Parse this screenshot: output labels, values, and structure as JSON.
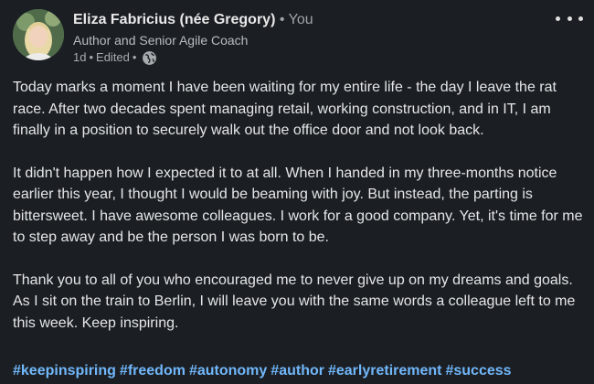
{
  "author": {
    "name": "Eliza Fabricius (née Gregory)",
    "bullet": "•",
    "relation": "You",
    "headline": "Author and Senior Agile Coach",
    "time": "1d",
    "edited": "Edited",
    "visibility_icon": "globe-icon"
  },
  "menu_icon": "more-options-icon",
  "post": {
    "paragraphs": [
      "Today marks a moment I have been waiting for my entire life - the day I leave the rat race. After two decades spent managing retail, working construction, and in IT, I am finally in a position to securely walk out the office door and not look back.",
      "It didn't happen how I expected it to at all. When I handed in my three-months notice earlier this year, I thought I would be beaming with joy. But instead, the parting is bittersweet. I have awesome colleagues. I work for a good company. Yet, it's time for me to step away and be the person I was born to be.",
      "Thank you to all of you who encouraged me to never give up on my dreams and goals. As I sit on the train to Berlin, I will leave you with the same words a colleague left to me this week. Keep inspiring."
    ],
    "hashtags": [
      "#keepinspiring",
      "#freedom",
      "#autonomy",
      "#author",
      "#earlyretirement",
      "#success"
    ]
  },
  "colors": {
    "background": "#1b1f23",
    "hashtag": "#71b7fb",
    "text": "#e4e6e8"
  }
}
